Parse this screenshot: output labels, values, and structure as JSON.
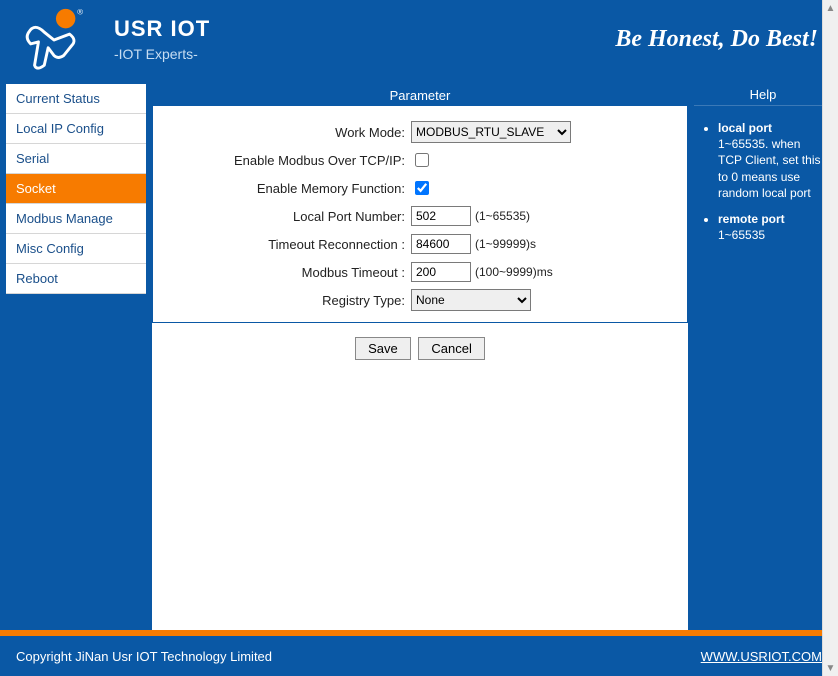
{
  "header": {
    "brand_title": "USR IOT",
    "brand_sub": "-IOT Experts-",
    "slogan": "Be Honest, Do Best!"
  },
  "nav": {
    "items": [
      {
        "label": "Current Status",
        "active": false
      },
      {
        "label": "Local IP Config",
        "active": false
      },
      {
        "label": "Serial",
        "active": false
      },
      {
        "label": "Socket",
        "active": true
      },
      {
        "label": "Modbus Manage",
        "active": false
      },
      {
        "label": "Misc Config",
        "active": false
      },
      {
        "label": "Reboot",
        "active": false
      }
    ]
  },
  "panel": {
    "title": "Parameter",
    "rows": {
      "work_mode": {
        "label": "Work Mode:",
        "value": "MODBUS_RTU_SLAVE"
      },
      "enable_modbus_tcp": {
        "label": "Enable Modbus Over TCP/IP:",
        "checked": false
      },
      "enable_memory": {
        "label": "Enable Memory Function:",
        "checked": true
      },
      "local_port": {
        "label": "Local Port Number:",
        "value": "502",
        "hint": "(1~65535)"
      },
      "timeout_reconn": {
        "label": "Timeout Reconnection :",
        "value": "84600",
        "hint": "(1~99999)s"
      },
      "modbus_timeout": {
        "label": "Modbus Timeout :",
        "value": "200",
        "hint": "(100~9999)ms"
      },
      "registry_type": {
        "label": "Registry Type:",
        "value": "None"
      }
    },
    "buttons": {
      "save": "Save",
      "cancel": "Cancel"
    }
  },
  "help": {
    "title": "Help",
    "items": [
      {
        "title": "local port",
        "body": "1~65535. when TCP Client, set this to 0 means use random local port"
      },
      {
        "title": "remote port",
        "body": "1~65535"
      }
    ]
  },
  "footer": {
    "copyright": "Copyright JiNan Usr IOT Technology Limited",
    "link": "WWW.USRIOT.COM"
  }
}
